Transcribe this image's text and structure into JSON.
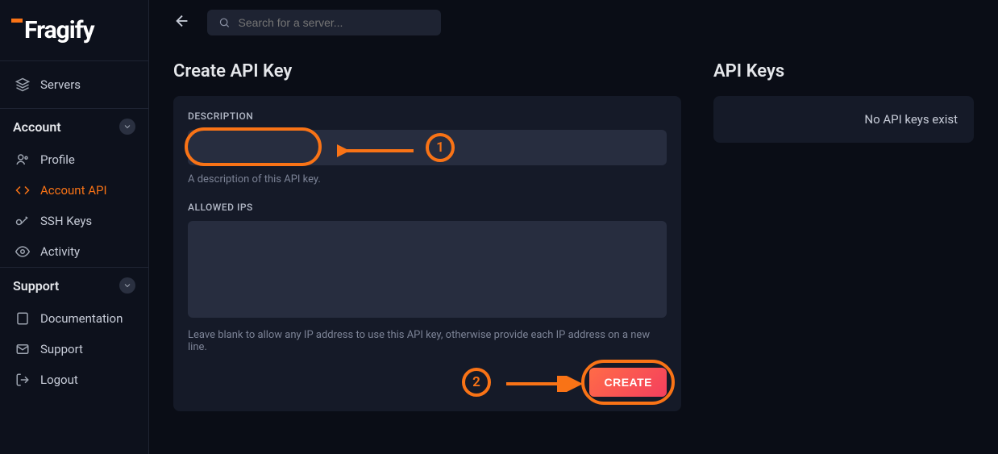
{
  "brand": "Fragify",
  "header": {
    "search_placeholder": "Search for a server..."
  },
  "sidebar": {
    "servers_label": "Servers",
    "account_header": "Account",
    "account_items": [
      {
        "label": "Profile",
        "icon": "user-icon"
      },
      {
        "label": "Account API",
        "icon": "code-icon",
        "active": true
      },
      {
        "label": "SSH Keys",
        "icon": "key-icon"
      },
      {
        "label": "Activity",
        "icon": "eye-icon"
      }
    ],
    "support_header": "Support",
    "support_items": [
      {
        "label": "Documentation",
        "icon": "book-icon"
      },
      {
        "label": "Support",
        "icon": "mail-icon"
      },
      {
        "label": "Logout",
        "icon": "logout-icon"
      }
    ]
  },
  "create_panel": {
    "title": "Create API Key",
    "description_label": "DESCRIPTION",
    "description_helper": "A description of this API key.",
    "allowed_ips_label": "ALLOWED IPS",
    "allowed_ips_helper": "Leave blank to allow any IP address to use this API key, otherwise provide each IP address on a new line.",
    "create_button": "CREATE"
  },
  "keys_panel": {
    "title": "API Keys",
    "empty_message": "No API keys exist"
  },
  "annotations": {
    "step1": "1",
    "step2": "2"
  },
  "colors": {
    "accent": "#f97316",
    "background": "#0a0d16",
    "panel": "#151a28",
    "input": "#272d3f",
    "button_gradient_from": "#ff6b47",
    "button_gradient_to": "#f43f5e"
  }
}
